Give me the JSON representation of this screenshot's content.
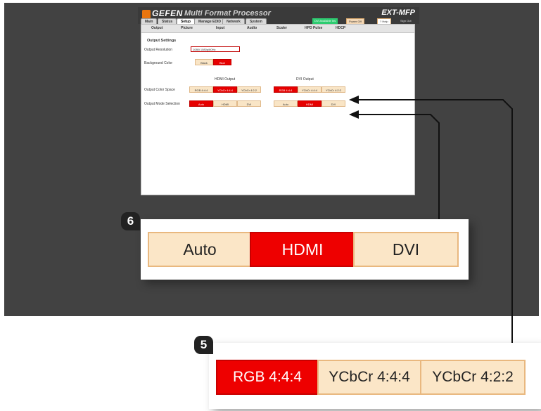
{
  "app": {
    "brand": "GEFEN",
    "title": "Multi Format Processor",
    "model": "EXT-MFP"
  },
  "main_tabs": [
    {
      "label": "Main"
    },
    {
      "label": "Status"
    },
    {
      "label": "Setup"
    },
    {
      "label": "Manage EDID"
    },
    {
      "label": "Network"
    },
    {
      "label": "System"
    }
  ],
  "active_main_tab": "Setup",
  "top_controls": {
    "status_label": "DVI Available Ins",
    "power_label": "Power Off",
    "help_label": "? Help",
    "logout_label": "Sign Out"
  },
  "sub_tabs": [
    {
      "label": "Output"
    },
    {
      "label": "Picture"
    },
    {
      "label": "Input"
    },
    {
      "label": "Audio"
    },
    {
      "label": "Scaler"
    },
    {
      "label": "HPD Pulse"
    },
    {
      "label": "HDCP"
    }
  ],
  "active_sub_tab": "Output",
  "output_settings": {
    "section_title": "Output Settings",
    "resolution_label": "Output Resolution",
    "resolution_value": "1080i 1080p/60Hz",
    "background_label": "Background Color",
    "background_options": [
      {
        "label": "Black",
        "selected": false
      },
      {
        "label": "Blue",
        "selected": true
      }
    ],
    "hdmi_heading": "HDMI Output",
    "dvi_heading": "DVI Output",
    "color_space_label": "Output Color Space",
    "mode_label": "Output Mode Selection",
    "hdmi_color_space": [
      {
        "label": "RGB 4:4:4",
        "selected": false
      },
      {
        "label": "YCbCr 4:4:4",
        "selected": true
      },
      {
        "label": "YCbCr 4:2:2",
        "selected": false
      }
    ],
    "dvi_color_space": [
      {
        "label": "RGB 4:4:4",
        "selected": true
      },
      {
        "label": "YCbCr 4:4:4",
        "selected": false
      },
      {
        "label": "YCbCr 4:2:2",
        "selected": false
      }
    ],
    "hdmi_mode": [
      {
        "label": "Auto",
        "selected": true
      },
      {
        "label": "HDMI",
        "selected": false
      },
      {
        "label": "DVI",
        "selected": false
      }
    ],
    "dvi_mode": [
      {
        "label": "Auto",
        "selected": false
      },
      {
        "label": "HDMI",
        "selected": true
      },
      {
        "label": "DVI",
        "selected": false
      }
    ]
  },
  "callout_6": {
    "badge": "6",
    "options": [
      {
        "label": "Auto",
        "selected": false
      },
      {
        "label": "HDMI",
        "selected": true
      },
      {
        "label": "DVI",
        "selected": false
      }
    ]
  },
  "callout_5": {
    "badge": "5",
    "options": [
      {
        "label": "RGB 4:4:4",
        "selected": true
      },
      {
        "label": "YCbCr 4:4:4",
        "selected": false
      },
      {
        "label": "YCbCr 4:2:2",
        "selected": false
      }
    ]
  },
  "colors": {
    "selected_red": "#ee0000",
    "unselected_peach": "#fbe6c7",
    "backdrop_gray": "#424242",
    "brand_orange": "#e8750f"
  }
}
